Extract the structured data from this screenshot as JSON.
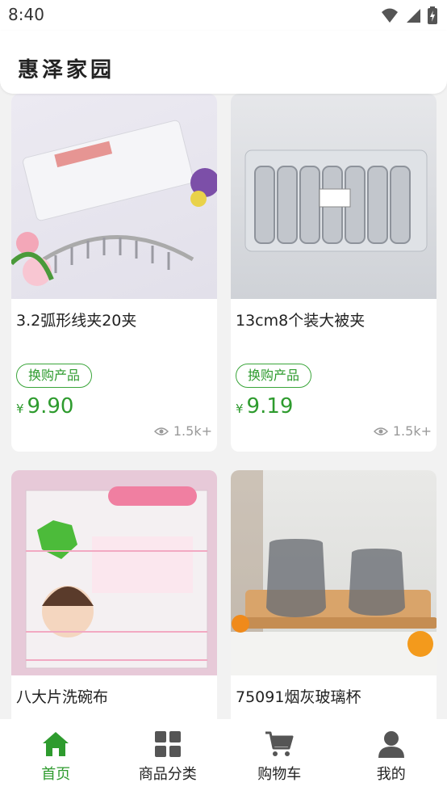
{
  "status_bar": {
    "time": "8:40"
  },
  "header": {
    "title": "惠泽家园"
  },
  "products": [
    {
      "name": "3.2弧形线夹20夹",
      "tag": "换购产品",
      "currency": "¥",
      "price": "9.90",
      "views": "1.5k+"
    },
    {
      "name": "13cm8个装大被夹",
      "tag": "换购产品",
      "currency": "¥",
      "price": "9.19",
      "views": "1.5k+"
    },
    {
      "name": "八大片洗碗布"
    },
    {
      "name": "75091烟灰玻璃杯"
    }
  ],
  "tabs": [
    {
      "label": "首页",
      "icon": "home-icon",
      "active": true
    },
    {
      "label": "商品分类",
      "icon": "category-grid-icon",
      "active": false
    },
    {
      "label": "购物车",
      "icon": "cart-icon",
      "active": false
    },
    {
      "label": "我的",
      "icon": "user-icon",
      "active": false
    }
  ],
  "colors": {
    "accent": "#2e9b2e",
    "background": "#f2f2f2"
  }
}
